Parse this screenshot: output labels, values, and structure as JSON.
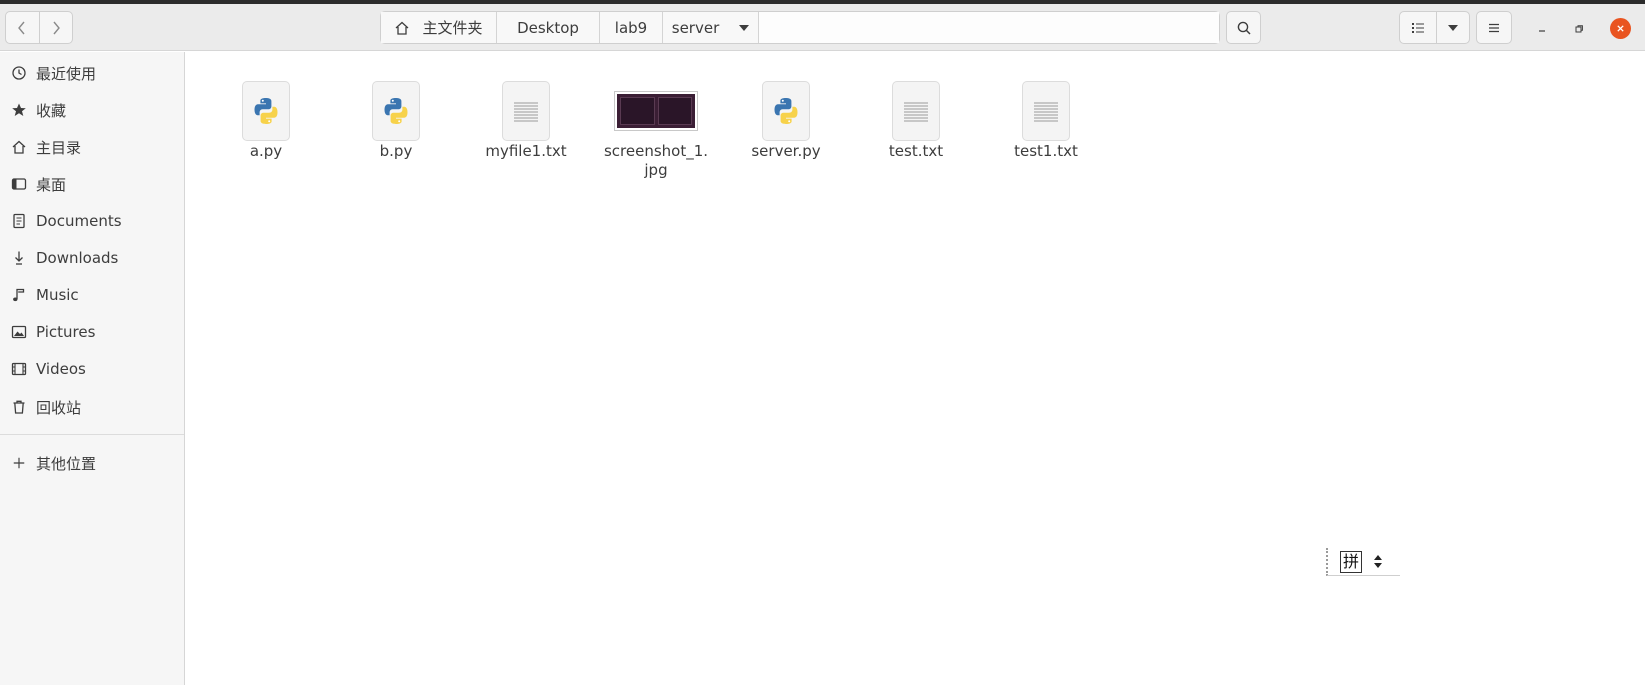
{
  "header": {
    "breadcrumbs": [
      "主文件夹",
      "Desktop",
      "lab9",
      "server"
    ]
  },
  "sidebar": {
    "items": [
      {
        "label": "最近使用",
        "icon": "recent-icon"
      },
      {
        "label": "收藏",
        "icon": "star-icon"
      },
      {
        "label": "主目录",
        "icon": "home-icon"
      },
      {
        "label": "桌面",
        "icon": "desktop-icon"
      },
      {
        "label": "Documents",
        "icon": "documents-icon"
      },
      {
        "label": "Downloads",
        "icon": "downloads-icon"
      },
      {
        "label": "Music",
        "icon": "music-icon"
      },
      {
        "label": "Pictures",
        "icon": "pictures-icon"
      },
      {
        "label": "Videos",
        "icon": "videos-icon"
      },
      {
        "label": "回收站",
        "icon": "trash-icon"
      }
    ],
    "other_places": "其他位置"
  },
  "files": [
    {
      "name": "a.py",
      "type": "python"
    },
    {
      "name": "b.py",
      "type": "python"
    },
    {
      "name": "myfile1.txt",
      "type": "text"
    },
    {
      "name": "screenshot_1.",
      "name2": "jpg",
      "type": "image"
    },
    {
      "name": "server.py",
      "type": "python"
    },
    {
      "name": "test.txt",
      "type": "text"
    },
    {
      "name": "test1.txt",
      "type": "text"
    }
  ],
  "ime": {
    "glyph": "拼"
  },
  "colors": {
    "accent_close": "#e95420",
    "python_blue": "#3a75b0",
    "python_yellow": "#f7d24a"
  }
}
